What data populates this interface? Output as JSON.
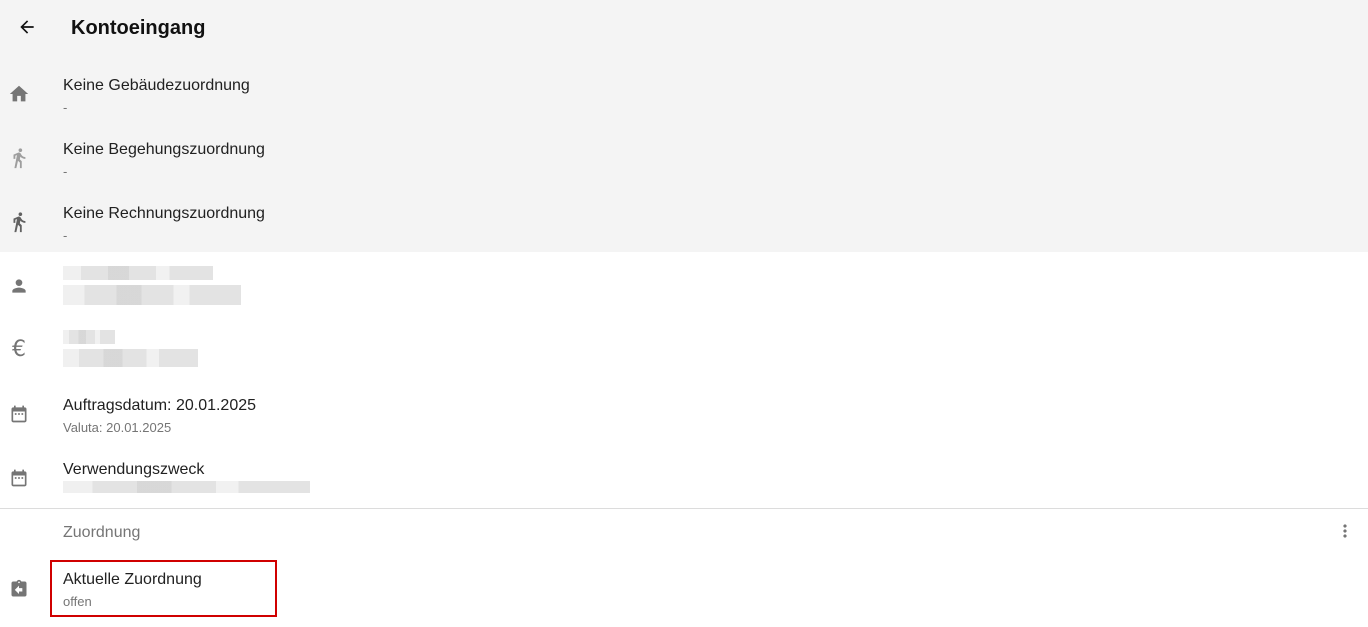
{
  "header": {
    "title": "Kontoeingang",
    "back_icon": "arrow-left-icon"
  },
  "assignments": [
    {
      "icon": "home-icon",
      "label": "Keine Gebäudezuordnung",
      "value": "-"
    },
    {
      "icon": "walk-icon",
      "label": "Keine Begehungszuordnung",
      "value": "-"
    },
    {
      "icon": "walk-icon",
      "label": "Keine Rechnungszuordnung",
      "value": "-"
    }
  ],
  "details": {
    "person_icon": "person-icon",
    "amount_icon": "euro-icon",
    "order_date": {
      "icon": "calendar-icon",
      "label": "Auftragsdatum: 20.01.2025",
      "value": "Valuta: 20.01.2025"
    },
    "purpose": {
      "icon": "calendar-icon",
      "label": "Verwendungszweck"
    }
  },
  "zuordnung": {
    "section_label": "Zuordnung",
    "more_icon": "more-vertical-icon",
    "current": {
      "icon": "assignment-return-icon",
      "label": "Aktuelle Zuordnung",
      "value": "offen"
    },
    "highlight_color": "#d00000"
  },
  "colors": {
    "header_bg": "#f4f4f4",
    "icon": "#757575",
    "text_primary": "#212121",
    "text_secondary": "#757575"
  }
}
